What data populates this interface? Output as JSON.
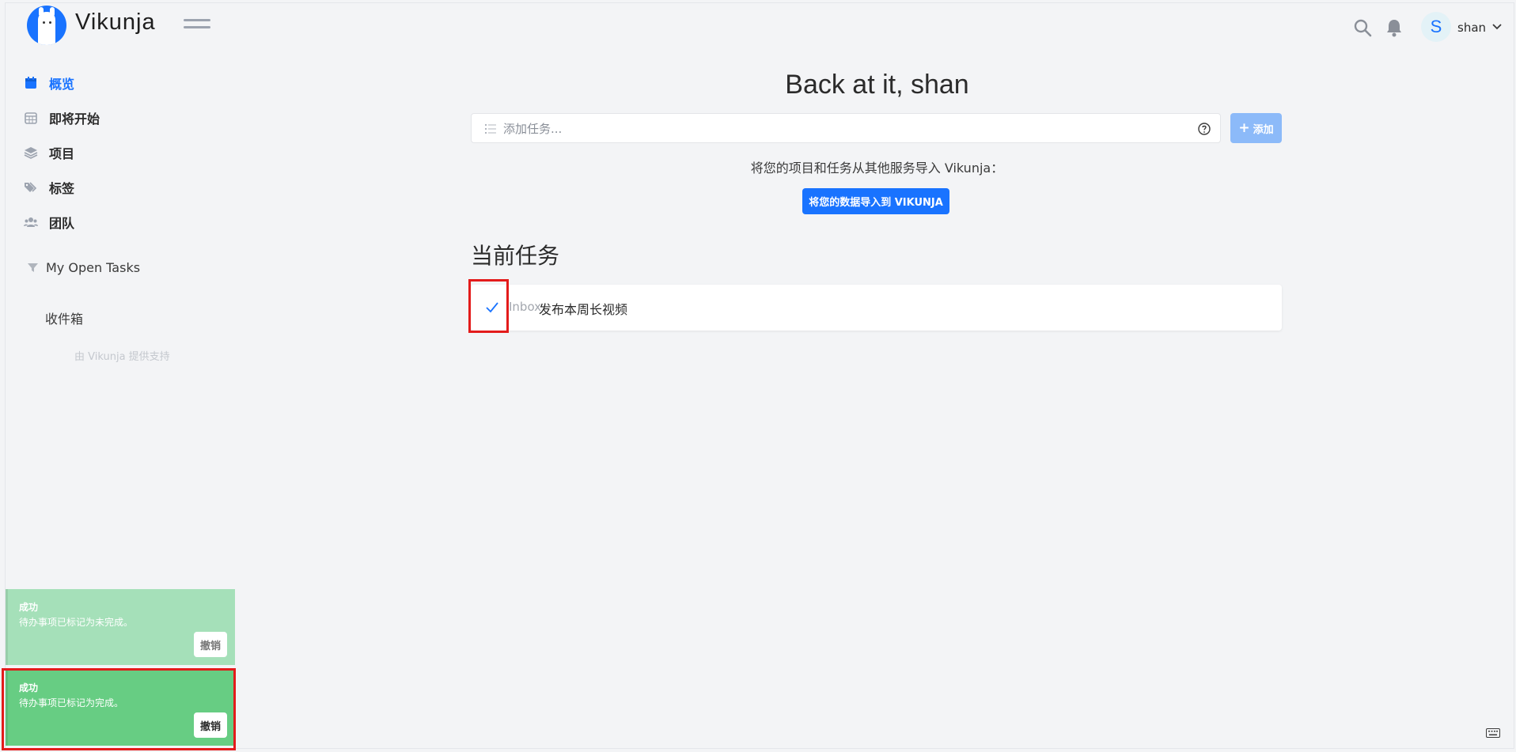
{
  "app": {
    "name": "Vikunja"
  },
  "header": {
    "user_initial": "S",
    "username": "shan"
  },
  "sidebar": {
    "items": [
      {
        "label": "概览",
        "icon": "calendar-icon",
        "active": true
      },
      {
        "label": "即将开始",
        "icon": "calendar-grid-icon",
        "active": false
      },
      {
        "label": "项目",
        "icon": "layers-icon",
        "active": false
      },
      {
        "label": "标签",
        "icon": "tags-icon",
        "active": false
      },
      {
        "label": "团队",
        "icon": "users-icon",
        "active": false
      }
    ],
    "saved_filter": "My Open Tasks",
    "project": "收件箱",
    "powered_by": "由 Vikunja 提供支持"
  },
  "main": {
    "welcome": "Back at it, shan",
    "add_task_placeholder": "添加任务...",
    "add_button": "添加",
    "import_text": "将您的项目和任务从其他服务导入 Vikunja：",
    "import_button": "将您的数据导入到 VIKUNJA",
    "section_title": "当前任务",
    "tasks": [
      {
        "project": "Inbox",
        "title": "发布本周长视频",
        "done": true
      }
    ]
  },
  "toasts": [
    {
      "title": "成功",
      "message": "待办事项已标记为未完成。",
      "action": "撤销"
    },
    {
      "title": "成功",
      "message": "待办事项已标记为完成。",
      "action": "撤销"
    }
  ],
  "colors": {
    "primary": "#1973ff",
    "success": "#67cd83",
    "success_faded": "#a5e0b9",
    "highlight": "#e31b1b"
  }
}
